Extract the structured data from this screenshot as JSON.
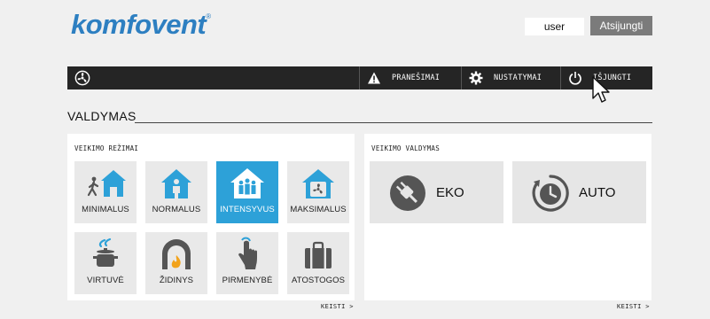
{
  "header": {
    "logo_text": "komfovent",
    "logo_mark": "®",
    "user_label": "user",
    "logout_label": "Atsijungti"
  },
  "nav": {
    "home_icon": "fan-icon",
    "items": [
      {
        "label": "PRANEŠIMAI",
        "icon": "warning-icon"
      },
      {
        "label": "NUSTATYMAI",
        "icon": "gear-icon"
      },
      {
        "label": "IŠJUNGTI",
        "icon": "power-icon"
      }
    ]
  },
  "page": {
    "title": "VALDYMAS"
  },
  "modes_panel": {
    "title": "VEIKIMO REŽIMAI",
    "change_label": "KEISTI >",
    "selected": "INTENSYVUS",
    "tiles": [
      {
        "label": "MINIMALUS",
        "icon": "walking-person-house-icon"
      },
      {
        "label": "NORMALUS",
        "icon": "person-house-icon"
      },
      {
        "label": "INTENSYVUS",
        "icon": "group-house-icon"
      },
      {
        "label": "MAKSIMALUS",
        "icon": "fan-house-icon"
      },
      {
        "label": "VIRTUVĖ",
        "icon": "cooking-pot-icon"
      },
      {
        "label": "ŽIDINYS",
        "icon": "fireplace-icon"
      },
      {
        "label": "PIRMENYBĖ",
        "icon": "pointing-hand-icon"
      },
      {
        "label": "ATOSTOGOS",
        "icon": "suitcase-icon"
      }
    ]
  },
  "control_panel": {
    "title": "VEIKIMO VALDYMAS",
    "change_label": "KEISTI >",
    "tiles": [
      {
        "label": "EKO",
        "icon": "eco-plug-icon"
      },
      {
        "label": "AUTO",
        "icon": "auto-clock-icon"
      }
    ]
  },
  "colors": {
    "brand": "#2d7fc1",
    "active_tile": "#2da1d8",
    "navbar": "#252525",
    "icon_gray": "#555555"
  }
}
